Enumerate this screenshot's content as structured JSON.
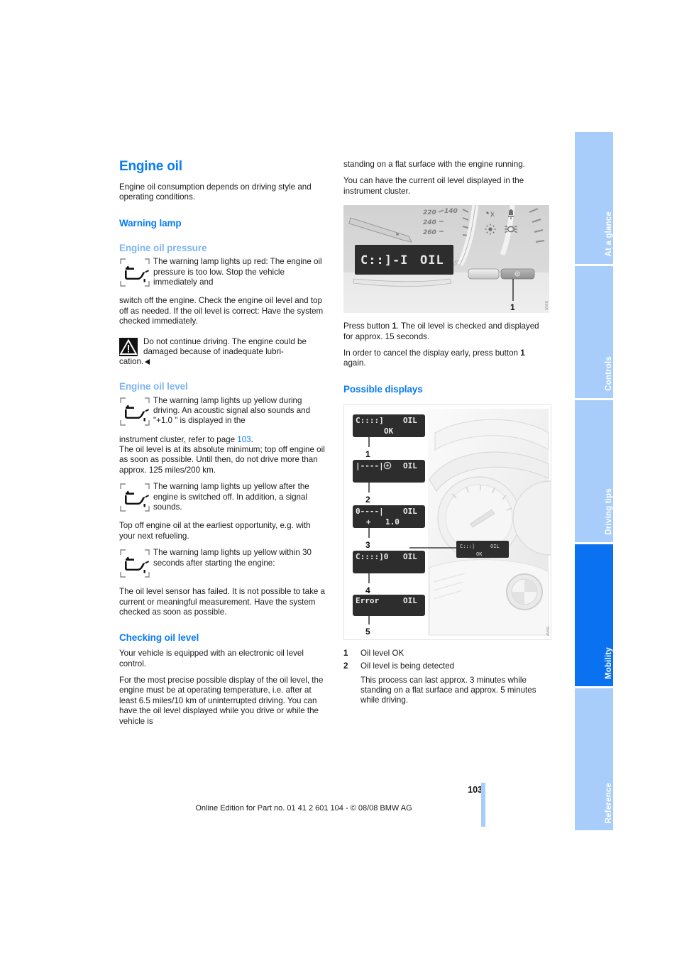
{
  "document": {
    "page_number": "103",
    "footer_note": "Online Edition for Part no. 01 41 2 601 104 - © 08/08 BMW AG"
  },
  "sidebar": {
    "tabs": [
      {
        "label": "At a glance",
        "active": false
      },
      {
        "label": "Controls",
        "active": false
      },
      {
        "label": "Driving tips",
        "active": false
      },
      {
        "label": "Mobility",
        "active": true
      },
      {
        "label": "Reference",
        "active": false
      }
    ],
    "active_color": "#0a72f0",
    "inactive_color": "#a8cdfa"
  },
  "left_column": {
    "section_title": "Engine oil",
    "intro": "Engine oil consumption depends on driving style and operating conditions.",
    "warning_lamp_heading": "Warning lamp",
    "oil_pressure": {
      "heading": "Engine oil pressure",
      "icon_text": "The warning lamp lights up red: The engine oil pressure is too low. Stop the vehicle immediately and",
      "continuation": "switch off the engine. Check the engine oil level and top off as needed. If the oil level is correct: Have the system checked immediately."
    },
    "warning_box": {
      "text": "Do not continue driving. The engine could be damaged because of inadequate lubri-",
      "continuation": "cation."
    },
    "oil_level": {
      "heading": "Engine oil level",
      "item1_icon_text": "The warning lamp lights up yellow during driving. An acoustic signal also sounds and \"+1.0 \" is displayed in the",
      "item1_cont_before": "instrument cluster, refer to page ",
      "item1_page_ref": "103",
      "item1_cont_after": ".",
      "item1_body": "The oil level is at its absolute minimum; top off engine oil as soon as possible. Until then, do not drive more than approx. 125 miles/200 km.",
      "item2_icon_text": "The warning lamp lights up yellow after the engine is switched off. In addition, a signal sounds.",
      "item2_body": "Top off engine oil at the earliest opportunity, e.g. with your next refueling.",
      "item3_icon_text": "The warning lamp lights up yellow within 30 seconds after starting the engine:",
      "item3_body": "The oil level sensor has failed. It is not possible to take a current or meaningful measurement. Have the system checked as soon as possible."
    },
    "checking_oil_level": {
      "heading": "Checking oil level",
      "para1": "Your vehicle is equipped with an electronic oil level control.",
      "para2": "For the most precise possible display of the oil level, the engine must be at operating temperature, i.e. after at least 6.5 miles/10 km of uninterrupted driving. You can have the oil level displayed while you drive or while the vehicle is"
    }
  },
  "right_column": {
    "continuation_para": "standing on a flat surface with the engine running.",
    "para2": "You can have the current oil level displayed in the instrument cluster.",
    "cluster_figure": {
      "caption_number": "1",
      "lcd_left": "C::]-I",
      "lcd_right": "OIL",
      "gauge_labels": [
        "220",
        "140",
        "240",
        "260"
      ],
      "watermark": "BMW"
    },
    "press_button_para_before": "Press button ",
    "press_button_bold": "1",
    "press_button_para_after": ". The oil level is checked and displayed for approx. 15 seconds.",
    "cancel_para_before": "In order to cancel the display early, press button ",
    "cancel_bold": "1",
    "cancel_para_after": " again.",
    "possible_displays_heading": "Possible displays",
    "displays": [
      {
        "number": "1",
        "bar": "C::::]",
        "right": "OIL",
        "second_line": "OK",
        "plus": ""
      },
      {
        "number": "2",
        "bar": "|----|",
        "right": "OIL",
        "second_line": "",
        "plus": ""
      },
      {
        "number": "3",
        "bar": "0----|",
        "right": "OIL",
        "second_line": "1.0",
        "plus": "+"
      },
      {
        "number": "4",
        "bar": "C::::]0",
        "right": "OIL",
        "second_line": "",
        "plus": ""
      },
      {
        "number": "5",
        "bar": "Error",
        "right": "OIL",
        "second_line": "",
        "plus": ""
      }
    ],
    "legend": [
      {
        "num": "1",
        "text": "Oil level OK",
        "sub": ""
      },
      {
        "num": "2",
        "text": "Oil level is being detected",
        "sub": "This process can last approx. 3 minutes while standing on a flat surface and approx. 5 minutes while driving."
      }
    ]
  }
}
